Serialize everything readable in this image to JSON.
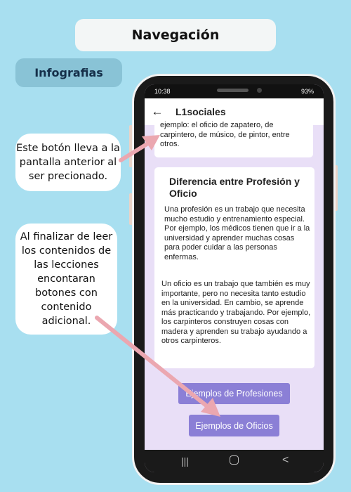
{
  "header": {
    "title": "Navegación",
    "section": "Infografias"
  },
  "notes": {
    "back_note": "Este botón lleva a la pantalla anterior al ser precionado.",
    "end_note": "Al finalizar de leer los contenidos de las lecciones encontaran botones con contenido adicional."
  },
  "phone": {
    "status": {
      "time": "10:38",
      "battery": "93%"
    },
    "app_bar": {
      "title": "L1sociales"
    },
    "top_card_text": "ejemplo: el oficio de zapatero, de carpintero, de músico, de pintor, entre otros.",
    "main_card": {
      "title": "Diferencia entre Profesión y Oficio",
      "profession_text": "Una profesión es un trabajo que necesita mucho estudio y entrenamiento especial. Por ejemplo, los médicos tienen que ir a la universidad y aprender muchas cosas para poder cuidar a las personas enfermas.",
      "trade_text": "Un oficio es un trabajo que también es muy importante, pero no necesita tanto estudio en la universidad. En cambio, se aprende más practicando y trabajando. Por ejemplo, los carpinteros construyen cosas con madera y aprenden su trabajo ayudando a otros carpinteros."
    },
    "buttons": {
      "professions": "Ejemplos de Profesiones",
      "trades": "Ejemplos de Oficios"
    },
    "nav": {
      "recent": "|||",
      "back": "<"
    },
    "icons": {
      "back": "arrow-left-icon",
      "home": "home-icon",
      "recent": "recent-apps-icon"
    }
  },
  "colors": {
    "background": "#a8dff0",
    "accent": "#8b7fd6",
    "arrow": "#eba7b0"
  }
}
